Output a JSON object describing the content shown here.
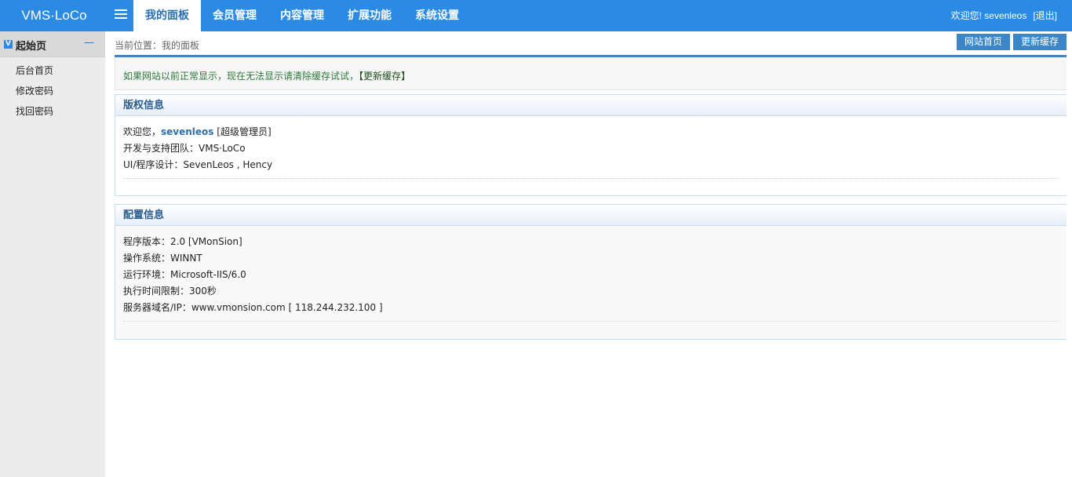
{
  "header": {
    "logo": "VMS·LoCo",
    "nav": [
      {
        "label": "我的面板",
        "active": true
      },
      {
        "label": "会员管理",
        "active": false
      },
      {
        "label": "内容管理",
        "active": false
      },
      {
        "label": "扩展功能",
        "active": false
      },
      {
        "label": "系统设置",
        "active": false
      }
    ],
    "welcome": "欢迎您! sevenleos",
    "logout": "[退出]"
  },
  "sidebar": {
    "badge": "V",
    "title": "起始页",
    "collapse": "—",
    "items": [
      {
        "label": "后台首页"
      },
      {
        "label": "修改密码"
      },
      {
        "label": "找回密码"
      }
    ]
  },
  "main": {
    "breadcrumb": "当前位置：我的面板",
    "btn_site_home": "网站首页",
    "btn_update_cache": "更新缓存",
    "notice": {
      "text": "如果网站以前正常显示，现在无法显示请清除缓存试试，",
      "link": "【更新缓存】"
    },
    "copyright": {
      "title": "版权信息",
      "welcome_prefix": "欢迎您，",
      "username": "sevenleos",
      "role": "[超级管理员]",
      "team": "开发与支持团队：VMS·LoCo",
      "design": "UI/程序设计：SevenLeos , Hency"
    },
    "config": {
      "title": "配置信息",
      "rows": [
        "程序版本：2.0 [VMonSion]",
        "操作系统：WINNT",
        "运行环境：Microsoft-IIS/6.0",
        "执行时间限制：300秒",
        "服务器域名/IP：www.vmonsion.com [ 118.244.232.100 ]"
      ]
    }
  },
  "colors": {
    "topbar": "#2b8be4",
    "accent": "#3a86c8",
    "notice_text": "#2b7a3a"
  }
}
